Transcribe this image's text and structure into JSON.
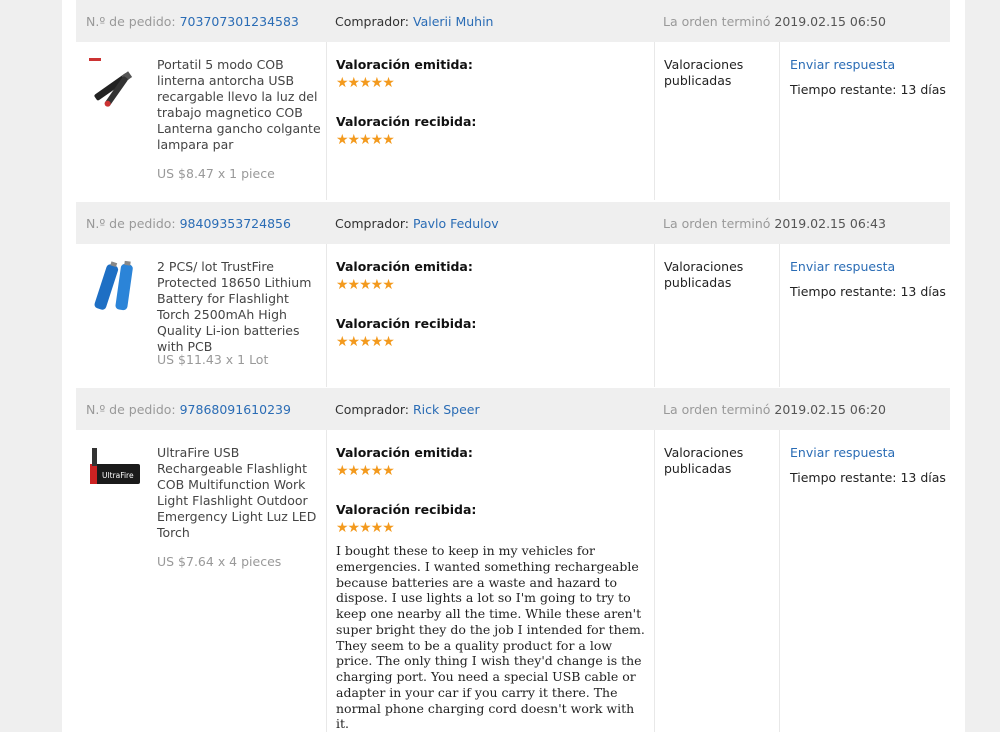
{
  "labels": {
    "order_prefix": "N.º de pedido: ",
    "buyer_prefix": "Comprador: ",
    "ended_prefix": "La orden terminó ",
    "emitted": "Valoración emitida:",
    "received": "Valoración recibida:",
    "published": "Valoraciones publicadas",
    "reply": "Enviar respuesta",
    "remaining": "Tiempo restante: 13 días",
    "stars": "★★★★★"
  },
  "orders": [
    {
      "order_no": "703707301234583",
      "buyer": "Valerii Muhin",
      "ended": "2019.02.15 06:50",
      "product": "Portatil 5 modo COB linterna antorcha USB recargable llevo la luz del trabajo magnetico COB Lanterna gancho colgante lampara par",
      "price": "US $8.47 x 1 piece",
      "thumb_icon": "flashlight-icon",
      "review": ""
    },
    {
      "order_no": "98409353724856",
      "buyer": "Pavlo Fedulov",
      "ended": "2019.02.15 06:43",
      "product": "2 PCS/ lot TrustFire Protected 18650 Lithium Battery for Flashlight Torch 2500mAh High Quality Li-ion batteries with PCB",
      "price": "US $11.43 x 1 Lot",
      "thumb_icon": "battery-icon",
      "review": ""
    },
    {
      "order_no": "97868091610239",
      "buyer": "Rick Speer",
      "ended": "2019.02.15 06:20",
      "product": "UltraFire USB Rechargeable Flashlight COB Multifunction Work Light Flashlight Outdoor Emergency Light Luz LED Torch",
      "price": "US $7.64 x 4 pieces",
      "thumb_icon": "worklight-icon",
      "thumb_brand": "UltraFire",
      "review": "I bought these to keep in my vehicles for emergencies. I wanted something rechargeable because batteries are a waste and hazard to dispose. I use lights a lot so I'm going to try to keep one nearby all the time. While these aren't super bright they do the job I intended for them. They seem to be a quality product for a low price. The only thing I wish they'd change is the charging port. You need a special USB cable or adapter in your car if you carry it there. The normal phone charging cord doesn't work with it."
    }
  ],
  "colors": {
    "link": "#2a6cb5",
    "star": "#f39a1e",
    "header_bg": "#efefef"
  }
}
